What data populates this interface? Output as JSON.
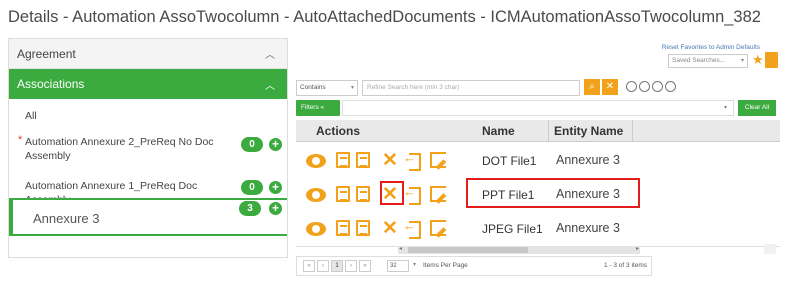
{
  "page_title": "Details - Automation AssoTwocolumn - AutoAttachedDocuments - ICMAutomationAssoTwocolumn_382",
  "left_panel": {
    "agreement_label": "Agreement",
    "associations_label": "Associations",
    "all_label": "All",
    "items": [
      {
        "label": "Automation Annexure 2_PreReq No Doc Assembly",
        "count": "0",
        "required": true
      },
      {
        "label": "Automation Annexure 1_PreReq Doc Assembly",
        "count": "0",
        "required": false
      },
      {
        "label": "Annexure 3",
        "count": "3",
        "required": false
      }
    ],
    "required_marker": "*"
  },
  "toolbar": {
    "reset_favorites": "Reset Favorites to Admin Defaults",
    "saved_searches_placeholder": "Saved Searches...",
    "contains_value": "Contains",
    "search_placeholder": "Refine Search here (min 3 char)",
    "filters_label": "Filters «",
    "clear_all_label": "Clear All"
  },
  "grid": {
    "columns": {
      "actions": "Actions",
      "name": "Name",
      "entity_name": "Entity Name"
    },
    "rows": [
      {
        "name": "DOT File1",
        "entity_name": "Annexure 3"
      },
      {
        "name": "PPT File1",
        "entity_name": "Annexure 3"
      },
      {
        "name": "JPEG File1",
        "entity_name": "Annexure 3"
      }
    ]
  },
  "pager": {
    "current_page": "1",
    "page_size": "32",
    "per_page_label": "Items Per Page",
    "range_label": "1 - 3 of 3 items",
    "first": "«",
    "prev": "‹",
    "next": "›",
    "last": "»"
  },
  "icons": {
    "view": "eye-icon",
    "details": "document-icon",
    "signature": "signature-icon",
    "delete": "close-icon",
    "move": "move-icon",
    "edit": "edit-doc-icon",
    "search": "search-icon"
  },
  "colors": {
    "accent_green": "#3bab3f",
    "icon_orange": "#f2a11a",
    "highlight_red": "#e31b1b"
  }
}
